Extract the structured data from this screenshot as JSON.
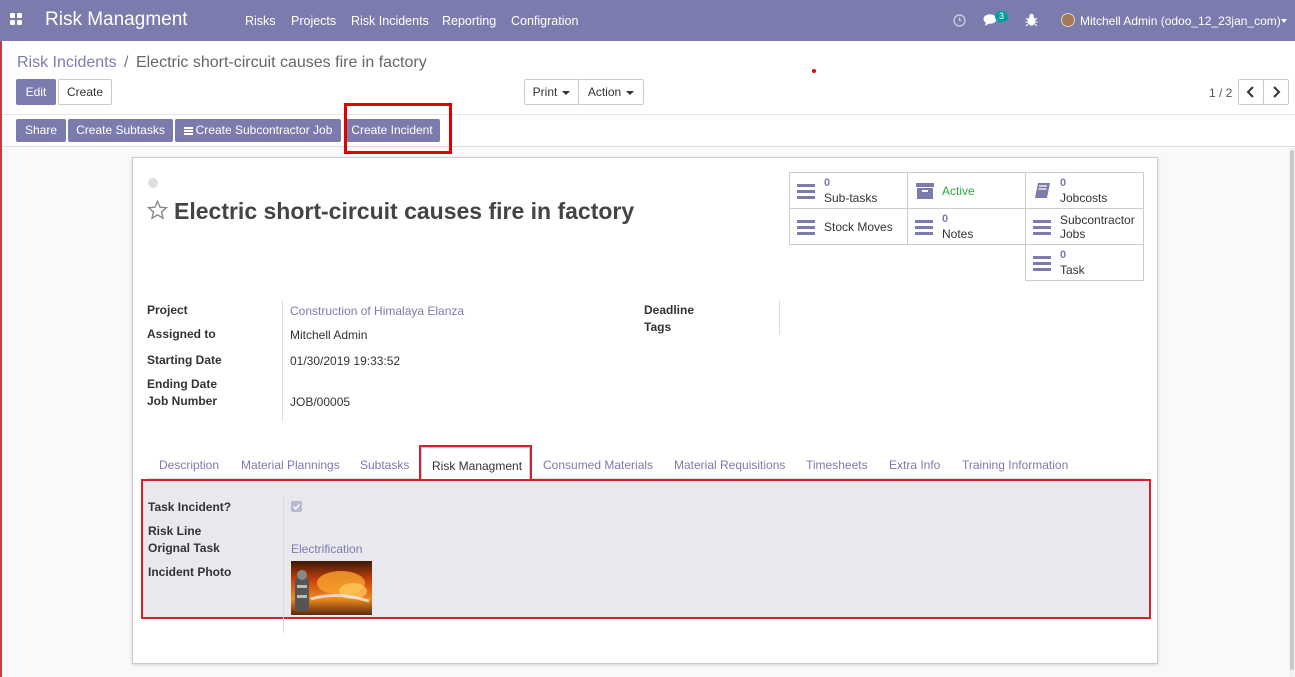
{
  "navbar": {
    "brand": "Risk Managment",
    "menu": [
      "Risks",
      "Projects",
      "Risk Incidents",
      "Reporting",
      "Configration"
    ],
    "messages_badge": "3",
    "user": "Mitchell Admin (odoo_12_23jan_com)",
    "color": "#7c7bad"
  },
  "breadcrumb": {
    "parent": "Risk Incidents",
    "separator": "/",
    "current": "Electric short-circuit causes fire in factory"
  },
  "buttons": {
    "edit": "Edit",
    "create": "Create",
    "print": "Print",
    "action": "Action",
    "pager": "1 / 2",
    "share": "Share",
    "create_subtasks": "Create Subtasks",
    "create_subcontractor_job": "Create Subcontractor Job",
    "create_incident": "Create Incident"
  },
  "record": {
    "title": "Electric short-circuit causes fire in factory"
  },
  "smart_buttons": {
    "subtasks": {
      "count": "0",
      "label": "Sub-tasks"
    },
    "active": {
      "label": "Active"
    },
    "jobcosts": {
      "count": "0",
      "label": "Jobcosts"
    },
    "stock_moves": {
      "label": "Stock Moves"
    },
    "notes": {
      "count": "0",
      "label": "Notes"
    },
    "subcontractor_jobs": {
      "label1": "Subcontractor",
      "label2": "Jobs"
    },
    "task": {
      "count": "0",
      "label": "Task"
    }
  },
  "fields": {
    "project": {
      "label": "Project",
      "value": "Construction of Himalaya Elanza"
    },
    "assigned_to": {
      "label": "Assigned to",
      "value": "Mitchell Admin"
    },
    "starting_date": {
      "label": "Starting Date",
      "value": "01/30/2019 19:33:52"
    },
    "ending_date": {
      "label": "Ending Date",
      "value": ""
    },
    "job_number": {
      "label": "Job Number",
      "value": "JOB/00005"
    },
    "deadline": {
      "label": "Deadline",
      "value": ""
    },
    "tags": {
      "label": "Tags",
      "value": ""
    }
  },
  "tabs": [
    "Description",
    "Material Plannings",
    "Subtasks",
    "Risk Managment",
    "Consumed Materials",
    "Material Requisitions",
    "Timesheets",
    "Extra Info",
    "Training Information"
  ],
  "active_tab": "Risk Managment",
  "risk_tab": {
    "task_incident": {
      "label": "Task Incident?",
      "checked": true
    },
    "risk_line": {
      "label": "Risk Line",
      "value": ""
    },
    "original_task": {
      "label": "Orignal Task",
      "value": "Electrification"
    },
    "incident_photo": {
      "label": "Incident Photo"
    }
  }
}
